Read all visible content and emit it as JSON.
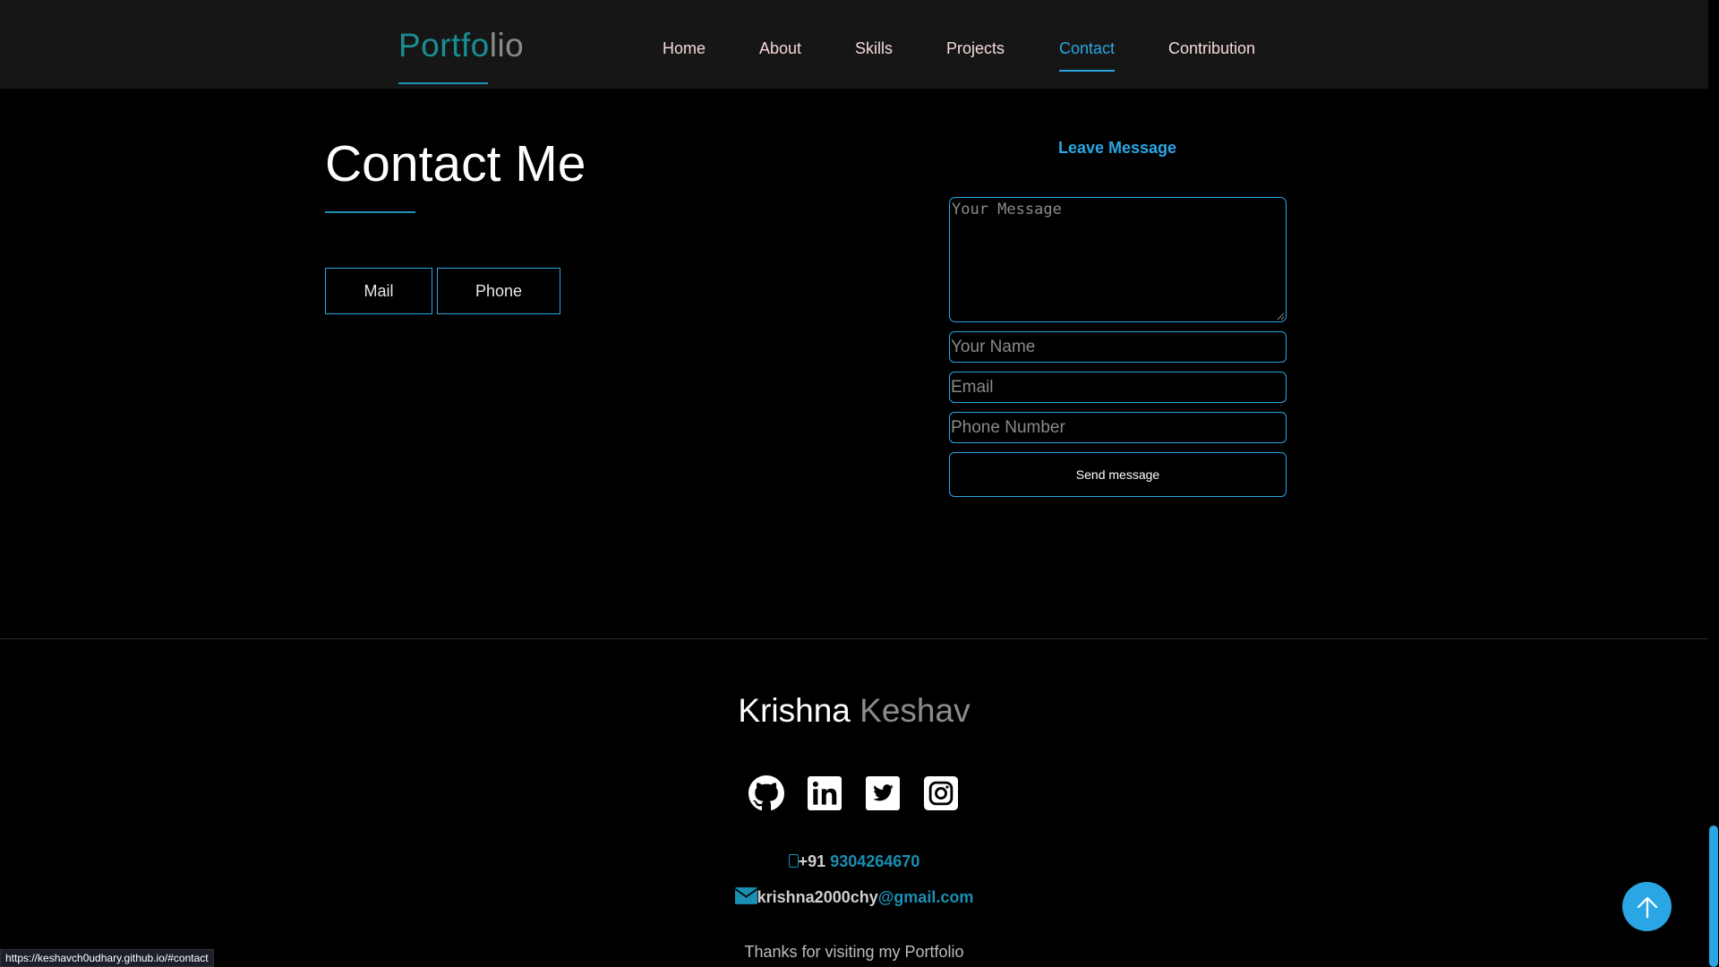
{
  "header": {
    "logo_part1": "Portfo",
    "logo_part2": "lio",
    "nav": [
      {
        "label": "Home"
      },
      {
        "label": "About"
      },
      {
        "label": "Skills"
      },
      {
        "label": "Projects"
      },
      {
        "label": "Contact",
        "active": true
      },
      {
        "label": "Contribution"
      }
    ]
  },
  "contact": {
    "title": "Contact Me",
    "tabs": [
      {
        "label": "Mail"
      },
      {
        "label": "Phone"
      }
    ]
  },
  "form": {
    "title": "Leave Message",
    "message_placeholder": "Your Message",
    "name_placeholder": "Your Name",
    "email_placeholder": "Email",
    "phone_placeholder": "Phone Number",
    "submit_label": "Send message"
  },
  "footer": {
    "first_name": "Krishna",
    "last_name": "Keshav",
    "social": [
      {
        "icon": "github-icon"
      },
      {
        "icon": "linkedin-icon"
      },
      {
        "icon": "twitter-icon"
      },
      {
        "icon": "instagram-icon"
      }
    ],
    "phone_prefix": "+91",
    "phone_number": "9304264670",
    "email_user": "krishna2000chy",
    "email_domain": "@gmail.com",
    "thanks": "Thanks for visiting my Portfolio"
  },
  "status_bar": {
    "url": "https://keshavch0udhary.github.io/#contact"
  },
  "colors": {
    "accent": "#2aa6e4",
    "logo_teal": "#1a8d93",
    "nav_text": "#f4d9d9"
  }
}
